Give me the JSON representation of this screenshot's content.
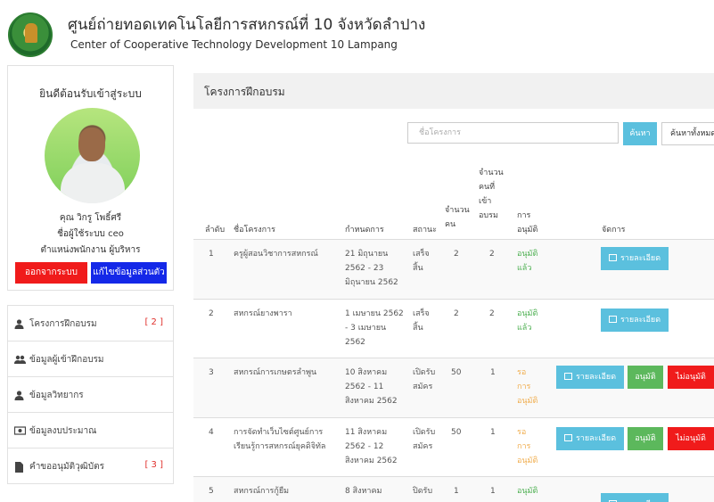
{
  "header": {
    "title": "ศูนย์ถ่ายทอดเทคโนโลยีการสหกรณ์ที่ 10 จังหวัดลำปาง",
    "subtitle": "Center of Cooperative Technology Development 10 Lampang"
  },
  "sidebar": {
    "welcome": "ยินดีต้อนรับเข้าสู่ระบบ",
    "name": "คุณ วิกรู โพธิ์ศรี",
    "login": "ชื่อผู้ใช้ระบบ ceo",
    "role": "ตำแหน่งพนักงาน ผู้บริหาร",
    "logout_label": "ออกจากระบบ",
    "profile_label": "แก้ไขข้อมูลส่วนตัว",
    "menu": [
      {
        "label": "โครงการฝึกอบรม",
        "badge": "[ 2 ]",
        "icon": "user-icon"
      },
      {
        "label": "ข้อมูลผู้เข้าฝึกอบรม",
        "badge": "",
        "icon": "users-icon"
      },
      {
        "label": "ข้อมูลวิทยากร",
        "badge": "",
        "icon": "user-icon"
      },
      {
        "label": "ข้อมูลงบประมาณ",
        "badge": "",
        "icon": "money-icon"
      },
      {
        "label": "คำขออนุมัติวุฒิบัตร",
        "badge": "[ 3 ]",
        "icon": "file-icon"
      }
    ]
  },
  "main": {
    "title": "โครงการฝึกอบรม",
    "search_placeholder": "ชื่อโครงการ",
    "search_button": "ค้นหา",
    "show_all_button": "ค้นหาทั้งหมด"
  },
  "table": {
    "headers": {
      "no": "ลำดับ",
      "name": "ชื่อโครงการ",
      "schedule": "กำหนดการ",
      "status": "สถานะ",
      "quota": "จำนวน คน",
      "attended": "จำนวน คนที่ เข้า อบรม",
      "approval": "การ อนุมัติ",
      "manage": "จัดการ"
    },
    "rows": [
      {
        "no": "1",
        "name": "ครูผู้สอนวิชาการสหกรณ์",
        "schedule": "21 มิถุนายน 2562 - 23 มิถุนายน 2562",
        "status": "เสร็จ สิ้น",
        "quota": "2",
        "attended": "2",
        "approval": "อนุมัติ แล้ว",
        "approval_state": "approved"
      },
      {
        "no": "2",
        "name": "สหกรณ์ยางพารา",
        "schedule": "1 เมษายน 2562 - 3 เมษายน 2562",
        "status": "เสร็จ สิ้น",
        "quota": "2",
        "attended": "2",
        "approval": "อนุมัติ แล้ว",
        "approval_state": "approved"
      },
      {
        "no": "3",
        "name": "สหกรณ์การเกษตรลำพูน",
        "schedule": "10 สิงหาคม 2562 - 11 สิงหาคม 2562",
        "status": "เปิดรับ สมัคร",
        "quota": "50",
        "attended": "1",
        "approval": "รอ การ อนุมัติ",
        "approval_state": "pending"
      },
      {
        "no": "4",
        "name": "การจัดทำเว็บไซต์ศูนย์การ เรียนรู้การสหกรณ์ยุคดิจิทัล",
        "schedule": "11 สิงหาคม 2562 - 12 สิงหาคม 2562",
        "status": "เปิดรับ สมัคร",
        "quota": "50",
        "attended": "1",
        "approval": "รอ การ อนุมัติ",
        "approval_state": "pending"
      },
      {
        "no": "5",
        "name": "สหกรณ์การกู้ยืม",
        "schedule": "8 สิงหาคม",
        "status": "ปิดรับ",
        "quota": "1",
        "attended": "1",
        "approval": "อนุมัติ",
        "approval_state": "approved"
      }
    ],
    "actions": {
      "detail": "รายละเอียด",
      "approve": "อนุมัติ",
      "reject": "ไม่อนุมัติ"
    }
  }
}
